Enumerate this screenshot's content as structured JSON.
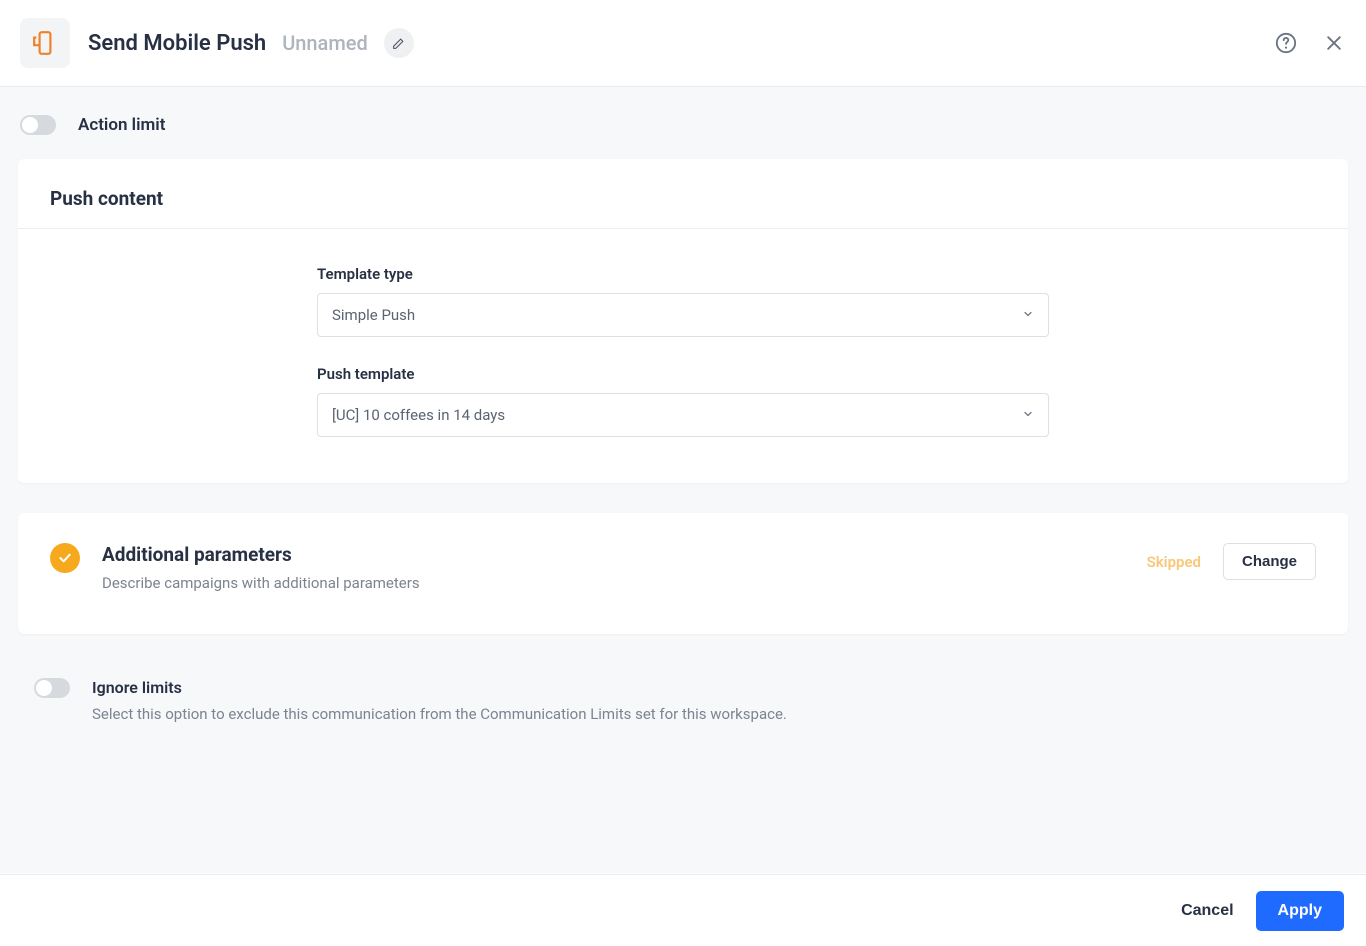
{
  "header": {
    "title": "Send Mobile Push",
    "subtitle": "Unnamed"
  },
  "actionLimit": {
    "label": "Action limit",
    "enabled": false
  },
  "pushContent": {
    "title": "Push content",
    "templateType": {
      "label": "Template type",
      "value": "Simple Push"
    },
    "pushTemplate": {
      "label": "Push template",
      "value": "[UC] 10 coffees in 14 days"
    }
  },
  "additionalParams": {
    "title": "Additional parameters",
    "description": "Describe campaigns with additional parameters",
    "status": "Skipped",
    "changeLabel": "Change"
  },
  "ignoreLimits": {
    "label": "Ignore limits",
    "description": "Select this option to exclude this communication from the Communication Limits set for this workspace.",
    "enabled": false
  },
  "footer": {
    "cancel": "Cancel",
    "apply": "Apply"
  }
}
